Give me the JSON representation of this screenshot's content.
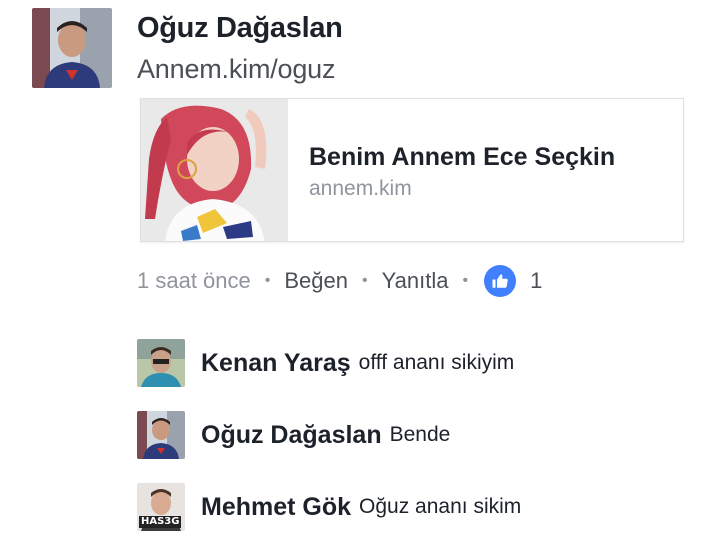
{
  "comment": {
    "author": "Oğuz Dağaslan",
    "link_text": "Annem.kim/oguz",
    "preview": {
      "title": "Benim Annem Ece Seçkin",
      "domain": "annem.kim"
    },
    "actions": {
      "time": "1 saat önce",
      "separator": "•",
      "like": "Beğen",
      "reply": "Yanıtla",
      "like_icon": "thumbs-up-icon",
      "like_count": "1"
    }
  },
  "replies": [
    {
      "name": "Kenan Yaraş",
      "text": "offf ananı sikiyim"
    },
    {
      "name": "Oğuz Dağaslan",
      "text": "Bende"
    },
    {
      "name": "Mehmet Gök",
      "text": "Oğuz ananı sikim",
      "avatar_tag": "HAS3G"
    }
  ],
  "colors": {
    "like_blue": "#4080ff",
    "text_dark": "#1d2129",
    "text_gray": "#90949c"
  }
}
